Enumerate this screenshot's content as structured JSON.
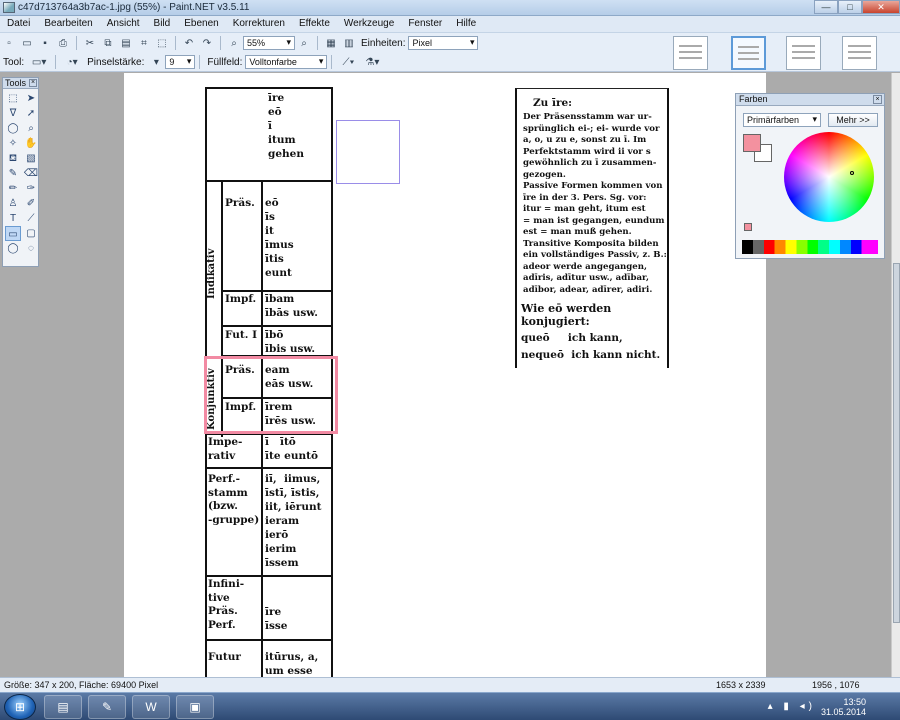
{
  "window": {
    "title": "c47d713764a3b7ac-1.jpg (55%) - Paint.NET v3.5.11"
  },
  "menu": [
    "Datei",
    "Bearbeiten",
    "Ansicht",
    "Bild",
    "Ebenen",
    "Korrekturen",
    "Effekte",
    "Werkzeuge",
    "Fenster",
    "Hilfe"
  ],
  "toolbar": {
    "zoom_value": "55%",
    "units_label": "Einheiten:",
    "units_value": "Pixel",
    "tool_label": "Tool:",
    "brush_label": "Pinselstärke:",
    "brush_value": "9",
    "fill_label": "Füllfeld:",
    "fill_value": "Volltonfarbe"
  },
  "tools_panel": {
    "title": "Tools"
  },
  "colors_panel": {
    "title": "Farben",
    "mode": "Primärfarben",
    "more_button": "Mehr >>",
    "primary_color": "#f3919f",
    "secondary_color": "#ffffff"
  },
  "document": {
    "top_cell": [
      "īre",
      "eō",
      "ī",
      "itum",
      "gehen"
    ],
    "section_labels": {
      "indikativ": "Indikativ",
      "konjunktiv": "Konjunktiv"
    },
    "rows": [
      {
        "label": "Präs.",
        "forms": [
          "eō",
          "īs",
          "it",
          "īmus",
          "ītis",
          "eunt"
        ]
      },
      {
        "label": "Impf.",
        "forms": [
          "ībam",
          "ībās usw."
        ]
      },
      {
        "label": "Fut. I",
        "forms": [
          "ībō",
          "ībis usw."
        ]
      },
      {
        "label": "Präs.",
        "forms": [
          "eam",
          "eās usw."
        ]
      },
      {
        "label": "Impf.",
        "forms": [
          "īrem",
          "īrēs usw."
        ]
      },
      {
        "label": "Impe-\nrativ",
        "forms": [
          "ī   ītō",
          "īte euntō"
        ]
      },
      {
        "label": "Perf.-\nstamm\n(bzw.\n-gruppe)",
        "forms": [
          "iī,  iimus,",
          "īstī, īstis,",
          "iit, iērunt",
          "ieram",
          "ierō",
          "ierim",
          "īssem"
        ]
      },
      {
        "label": "Infini-\ntive\nPräs.\nPerf.",
        "forms": [
          "",
          "",
          "īre",
          "īsse"
        ]
      },
      {
        "label": "Futur",
        "forms": [
          "itūrus, a,",
          "um esse"
        ]
      }
    ],
    "right_box": {
      "heading": "Zu īre:",
      "body": "Der Präsensstamm war ur-\nsprünglich ei-; ei- wurde vor\na, o, u zu e, sonst zu ī. Im\nPerfektstamm wird ii vor s\ngewöhnlich zu ī zusammen-\ngezogen.\nPassive Formen kommen von\nīre in der 3. Pers. Sg. vor:\nitur = man geht, itum est\n= man ist gegangen, eundum\nest = man muß gehen.\nTransitive Komposita bilden\nein vollständiges Passiv, z. B.:\nadeor werde angegangen,\nadīris, adītur usw., adībar,\nadībor, adear, adīrer, adiri.",
      "subheading": "Wie eō werden konjugiert:",
      "examples": "queō     ich kann,\nnequeō  ich kann nicht."
    }
  },
  "status": {
    "selection": "Größe: 347 x 200, Fläche: 69400 Pixel",
    "image_size": "1653 x 2339",
    "cursor": "1956 , 1076"
  },
  "taskbar": {
    "time": "13:50",
    "date": "31.05.2014"
  }
}
